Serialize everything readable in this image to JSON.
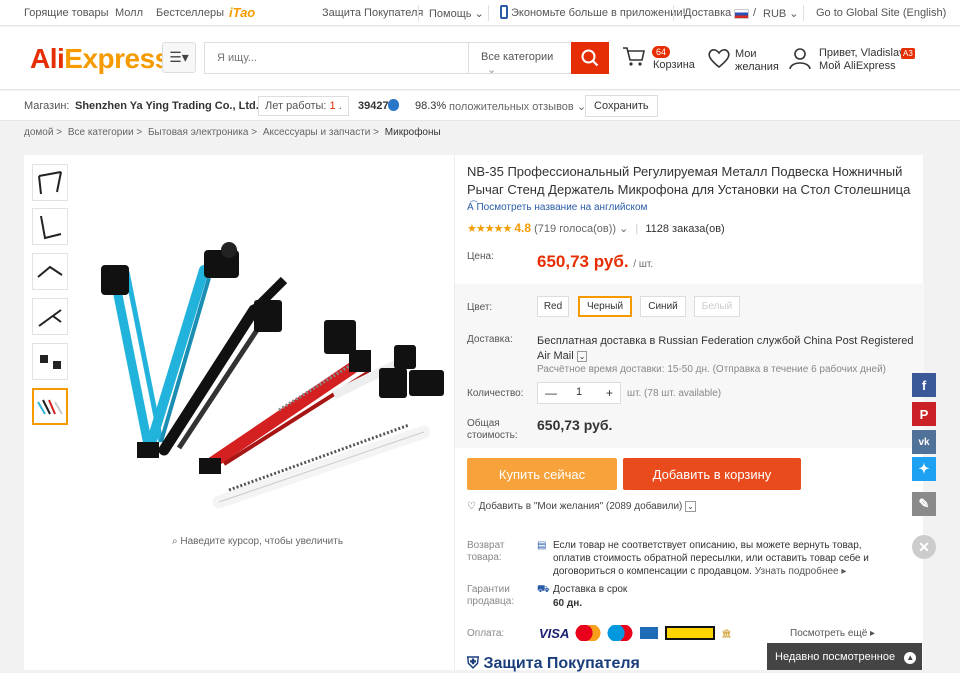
{
  "topbar": {
    "hot": "Горящие товары",
    "mall": "Молл",
    "best": "Бестселлеры",
    "itao": "iTao",
    "protection": "Защита Покупателя",
    "help": "Помощь",
    "app": "Экономьте больше в приложении!",
    "delivery": "Доставка в",
    "currency": "RUB",
    "global": "Go to Global Site (English)"
  },
  "header": {
    "logo_ali": "Ali",
    "logo_express": "Express",
    "search_placeholder": "Я ищу...",
    "category": "Все категории",
    "cart_count": "64",
    "cart_label": "Корзина",
    "wish_label": "Мои желания",
    "greeting": "Привет, Vladislav",
    "account": "Мой AliExpress",
    "badge": "A3"
  },
  "store": {
    "label": "Магазин:",
    "name": "Shenzhen Ya Ying Trading Co., Ltd.",
    "years_label": "Лет работы:",
    "years": "1",
    "score": "39427",
    "positive": "98.3%",
    "positive_label": "положительных отзывов",
    "save": "Сохранить"
  },
  "breadcrumb": [
    "домой",
    "Все категории",
    "Бытовая электроника",
    "Аксессуары и запчасти",
    "Микрофоны"
  ],
  "gallery": {
    "zoom_hint": "Наведите курсор, чтобы увеличить"
  },
  "product": {
    "title": "NB-35 Профессиональный Регулируемая Металл Подвеска Ножничный Рычаг Стенд Держатель Микрофона для Установки на Стол Столешница",
    "translate": "Посмотреть название на английском",
    "rating": "4.8",
    "votes": "(719 голоса(ов))",
    "orders": "1128 заказа(ов)",
    "price_label": "Цена:",
    "price": "650,73 руб.",
    "unit": "/ шт.",
    "color_label": "Цвет:",
    "colors": [
      "Red",
      "Черный",
      "Синий",
      "Белый"
    ],
    "shipping_label": "Доставка:",
    "shipping": "Бесплатная доставка в Russian Federation службой China Post Registered Air Mail",
    "shipping_time": "Расчётное время доставки: 15-50 дн. (Отправка в течение 6 рабочих дней)",
    "qty_label": "Количество:",
    "qty": "1",
    "qty_available": "шт. (78 шт. available)",
    "total_label": "Общая стоимость:",
    "total": "650,73 руб.",
    "buy_now": "Купить сейчас",
    "add_cart": "Добавить в корзину",
    "wish": "Добавить в \"Мои желания\" (2089 добавили)",
    "return_label": "Возврат товара:",
    "return_text": "Если товар не соответствует описанию, вы можете вернуть товар, оплатив стоимость обратной пересылки, или оставить товар себе и договориться о компенсации с продавцом.",
    "learn_more": "Узнать подробнее",
    "guarantee_label": "Гарантии продавца:",
    "guarantee_text": "Доставка в срок",
    "guarantee_days": "60 дн.",
    "payment_label": "Оплата:",
    "payment_more": "Посмотреть ещё",
    "protection": "Защита Покупателя"
  },
  "recent": "Недавно посмотренное"
}
